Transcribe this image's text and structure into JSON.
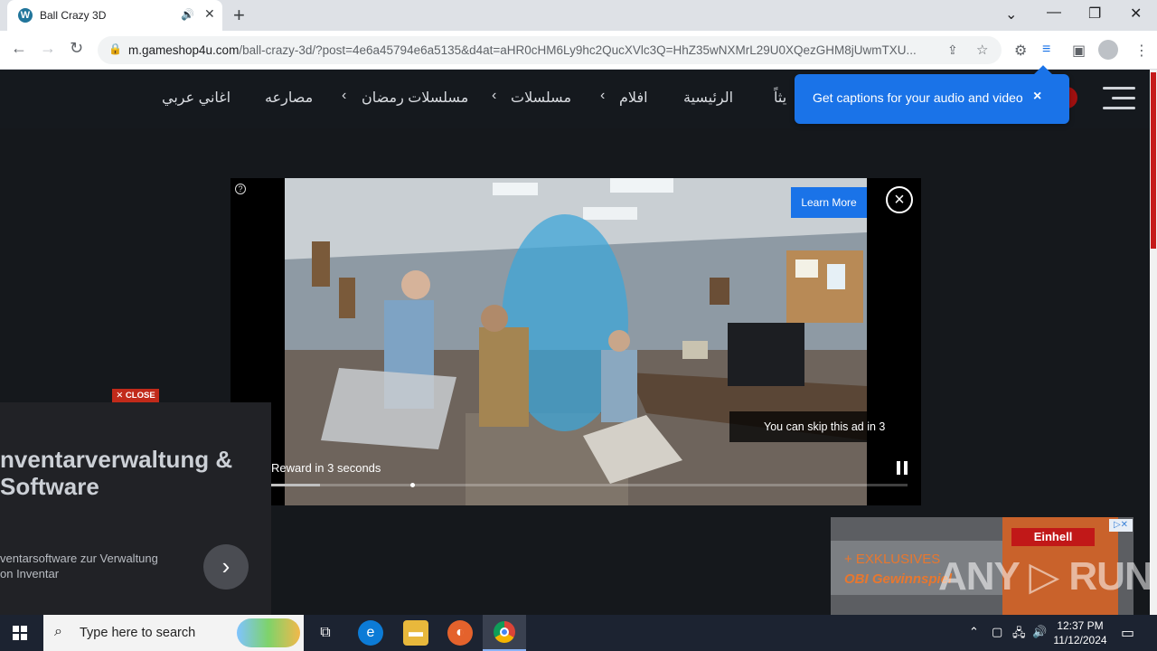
{
  "browser": {
    "tab_title": "Ball Crazy 3D",
    "tab_favicon": "W",
    "url_domain": "m.gameshop4u.com",
    "url_path": "/ball-crazy-3d/?post=4e6a45794e6a5135&d4at=aHR0cHM6Ly9hc2QucXVlc3Q=HhZ35wNXMrL29U0XQezGHM8jUwmTXU..."
  },
  "site_nav": {
    "items": [
      "الرئيسية",
      "افلام",
      "مسلسلات",
      "مسلسلات رمضان",
      "مصارعه",
      "اغاني عربي"
    ],
    "partial_item": "يثاً"
  },
  "caption_tooltip": {
    "text": "Get captions for your audio and video",
    "close": "×"
  },
  "video_ad": {
    "info": "?",
    "learn_more": "Learn More",
    "close": "×",
    "skip_text": "You can skip this ad in 3",
    "reward_text": "Reward in 3 seconds",
    "progress": 0.115
  },
  "left_ad": {
    "close_badge": "✕ CLOSE",
    "headline_line1": "nventarverwaltung &",
    "headline_line2": "Software",
    "desc_line1": "ventarsoftware zur Verwaltung",
    "desc_line2": "on Inventar",
    "next": "›"
  },
  "right_ad": {
    "promo1": "+ EXKLUSIVES",
    "promo2": "OBI Gewinnspiel",
    "brand": "Einhell",
    "adchoices": "▷✕"
  },
  "watermark": "ANY ▷ RUN",
  "taskbar": {
    "search_placeholder": "Type here to search",
    "time": "12:37 PM",
    "date": "11/12/2024"
  },
  "colors": {
    "accent_blue": "#1a73e8",
    "close_red": "#c12a1a",
    "site_bg": "#15181c"
  }
}
